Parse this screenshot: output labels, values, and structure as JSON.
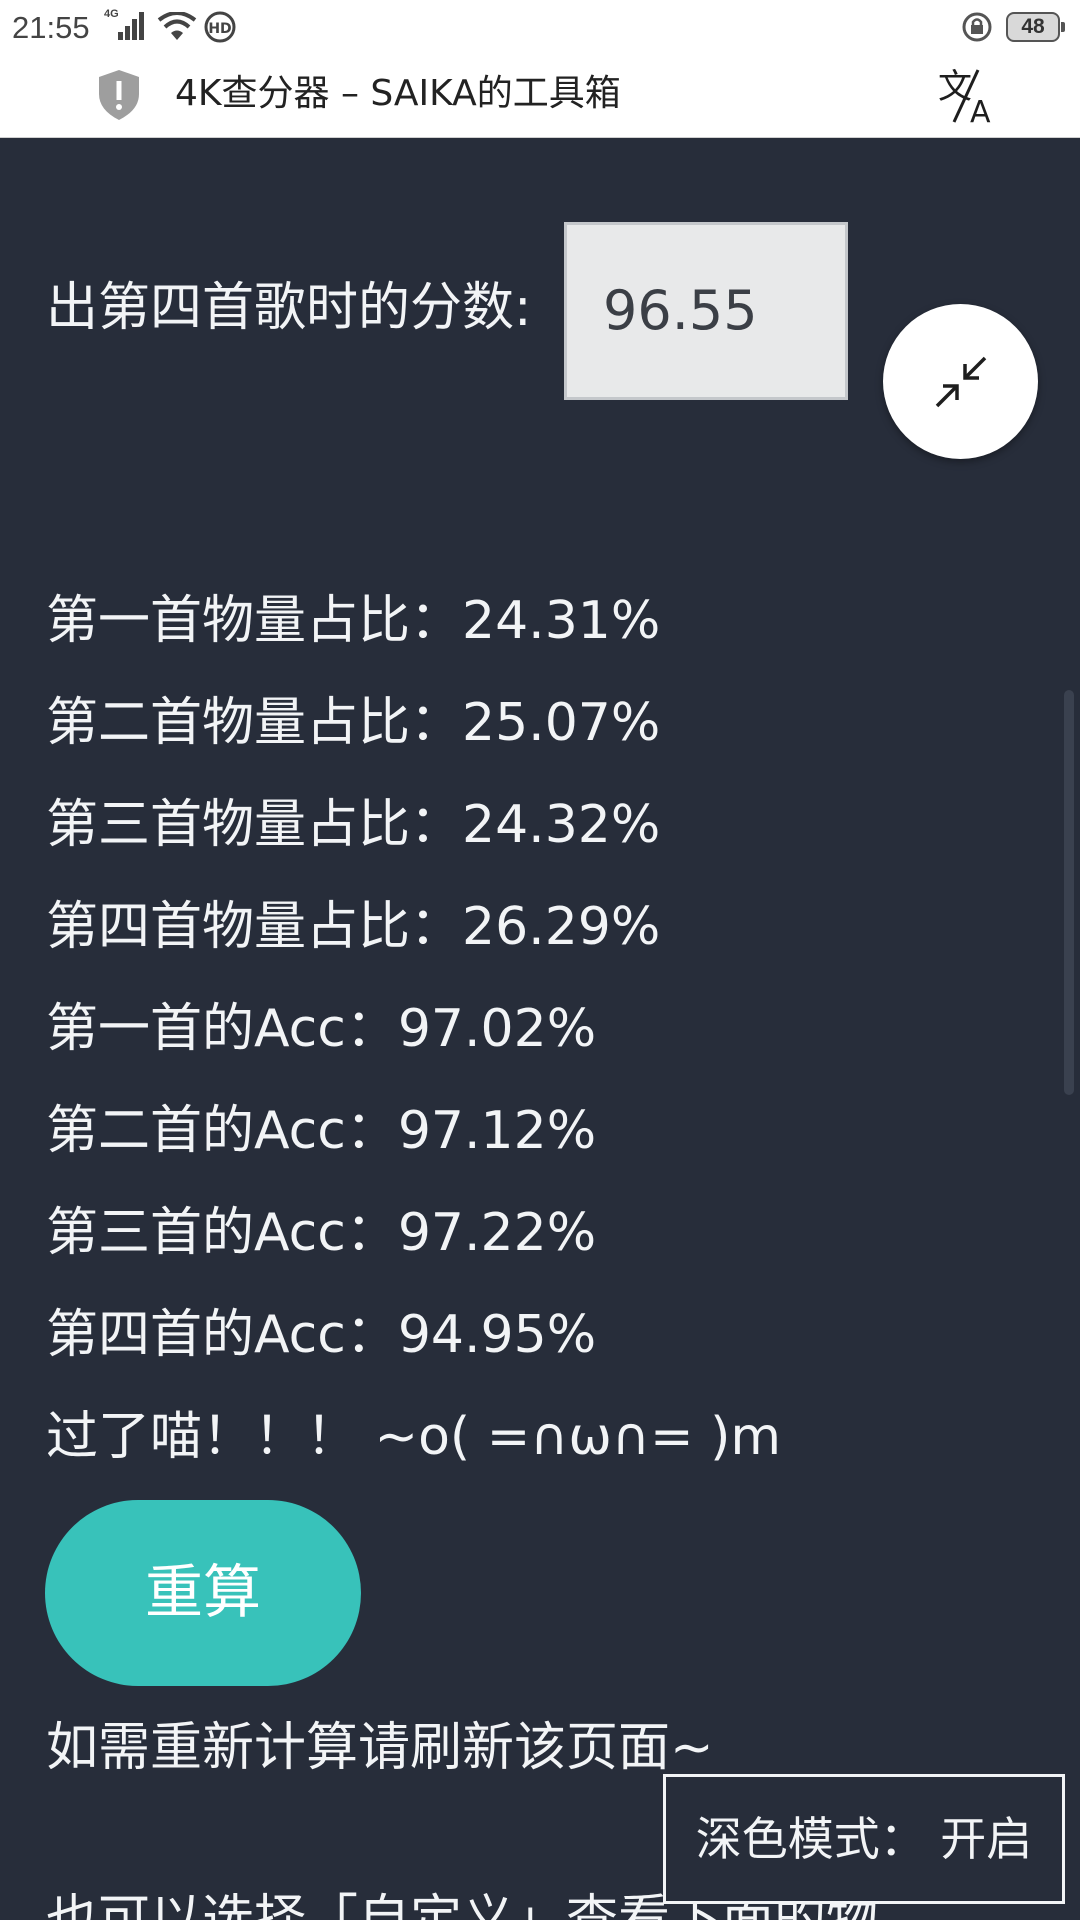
{
  "status_bar": {
    "time": "21:55",
    "network": "4G",
    "hd_badge": "HD",
    "battery": "48"
  },
  "title_bar": {
    "title": "4K查分器 – SAIKA的工具箱"
  },
  "calculator": {
    "score_label": "出第四首歌时的分数:",
    "score_value": "96.55"
  },
  "results": [
    "第一首物量占比：24.31%",
    "第二首物量占比：25.07%",
    "第三首物量占比：24.32%",
    "第四首物量占比：26.29%",
    "第一首的Acc：97.02%",
    "第二首的Acc：97.12%",
    "第三首的Acc：97.22%",
    "第四首的Acc：94.95%",
    "过了喵！！！ ~o( =∩ω∩= )m"
  ],
  "recalc_label": "重算",
  "hint_text": "如需重新计算请刷新该页面~",
  "hint_text_2": "也可以选择「自定义」查看下面的物",
  "dark_mode_toggle": "深色模式：  开启",
  "colors": {
    "background": "#272d3a",
    "accent": "#38c2ba",
    "text": "#f2f4f6"
  }
}
